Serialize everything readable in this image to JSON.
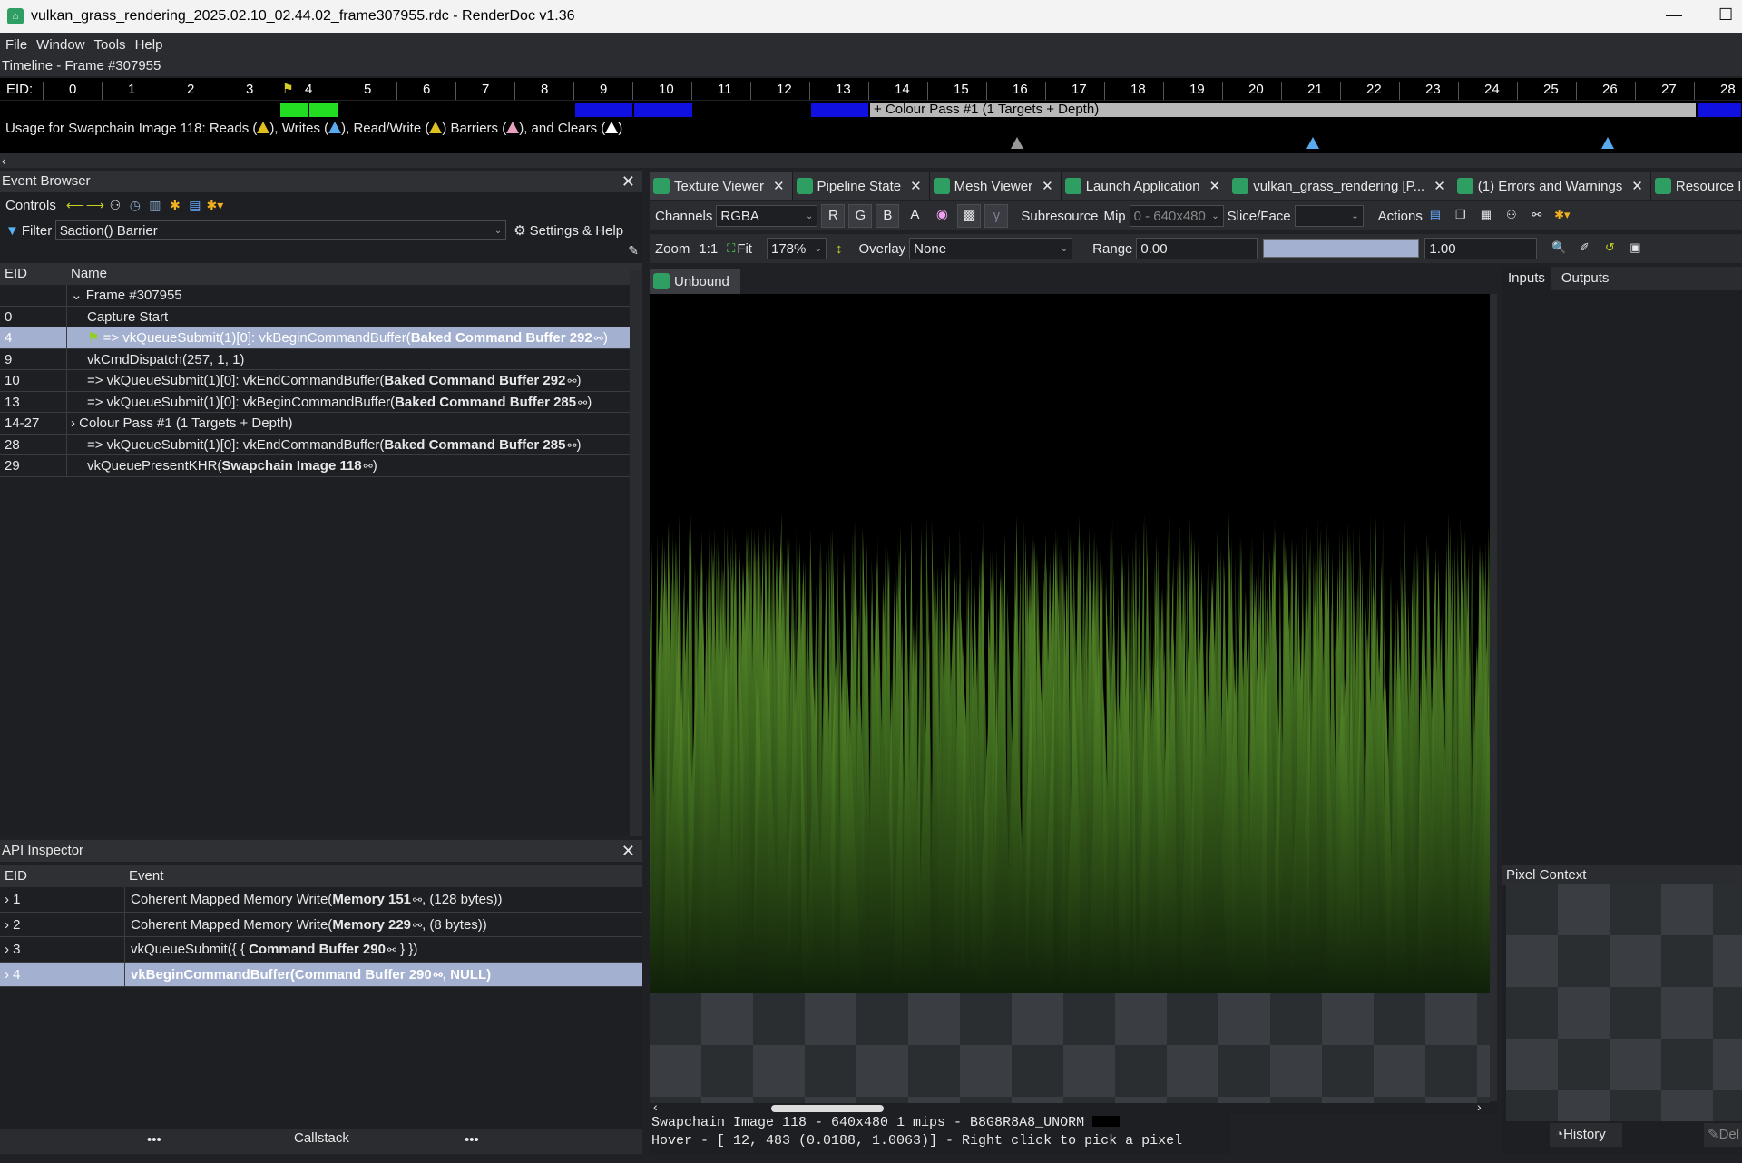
{
  "window": {
    "title": "vulkan_grass_rendering_2025.02.10_02.44.02_frame307955.rdc - RenderDoc v1.36"
  },
  "menu": [
    "File",
    "Window",
    "Tools",
    "Help"
  ],
  "timeline": {
    "title": "Timeline - Frame #307955",
    "eid_label": "EID:",
    "ticks": [
      "0",
      "1",
      "2",
      "3",
      "4",
      "5",
      "6",
      "7",
      "8",
      "9",
      "10",
      "11",
      "12",
      "13",
      "14",
      "15",
      "16",
      "17",
      "18",
      "19",
      "20",
      "21",
      "22",
      "23",
      "24",
      "25",
      "26",
      "27",
      "28"
    ],
    "pass_label": "+ Colour Pass #1 (1 Targets + Depth)",
    "usage": {
      "prefix": "Usage for Swapchain Image 118: Reads (",
      "writes": "), Writes (",
      "readwrite": "), Read/Write (",
      "barriers": ") Barriers (",
      "clears": "), and Clears (",
      "end": ")"
    },
    "colors": {
      "marker_green": "#22dd22",
      "marker_blue": "#1010e0",
      "pass_grey": "#b8b8b8",
      "reads": "#e0c020",
      "writes": "#5aaaf0",
      "barrier": "#e8a0c0"
    }
  },
  "event_browser": {
    "title": "Event Browser",
    "controls_label": "Controls",
    "filter_label": "Filter",
    "filter_value": "$action() Barrier",
    "settings_label": "Settings & Help",
    "col_eid": "EID",
    "col_name": "Name",
    "rows": [
      {
        "eid": "",
        "name": "Frame #307955",
        "expand": "v"
      },
      {
        "eid": "0",
        "name": "Capture Start"
      },
      {
        "eid": "4",
        "pre": "=> vkQueueSubmit(1)[0]: vkBeginCommandBuffer(",
        "bold": "Baked Command Buffer 292",
        "post": ")",
        "selected": true,
        "flag": true
      },
      {
        "eid": "9",
        "name": "vkCmdDispatch(257, 1, 1)"
      },
      {
        "eid": "10",
        "pre": "=> vkQueueSubmit(1)[0]: vkEndCommandBuffer(",
        "bold": "Baked Command Buffer 292",
        "post": ")"
      },
      {
        "eid": "13",
        "pre": "=> vkQueueSubmit(1)[0]: vkBeginCommandBuffer(",
        "bold": "Baked Command Buffer 285",
        "post": ")"
      },
      {
        "eid": "14-27",
        "name": "Colour Pass #1 (1 Targets + Depth)",
        "expand": ">"
      },
      {
        "eid": "28",
        "pre": "=> vkQueueSubmit(1)[0]: vkEndCommandBuffer(",
        "bold": "Baked Command Buffer 285",
        "post": ")"
      },
      {
        "eid": "29",
        "pre": "vkQueuePresentKHR(",
        "bold": "Swapchain Image 118",
        "post": ")"
      }
    ]
  },
  "api_inspector": {
    "title": "API Inspector",
    "col_eid": "EID",
    "col_event": "Event",
    "rows": [
      {
        "eid": "1",
        "pre": "Coherent Mapped Memory Write(",
        "bold": "Memory 151",
        "post": ", (128 bytes))"
      },
      {
        "eid": "2",
        "pre": "Coherent Mapped Memory Write(",
        "bold": "Memory 229",
        "post": ", (8 bytes))"
      },
      {
        "eid": "3",
        "pre": "vkQueueSubmit({ { ",
        "bold": "Command Buffer 290",
        "post": " } })"
      },
      {
        "eid": "4",
        "pre": "vkBeginCommandBuffer(",
        "bold": "Command Buffer 290",
        "post": ", NULL)",
        "selected": true
      }
    ],
    "callstack_label": "Callstack",
    "dots": "•••"
  },
  "tabs": [
    {
      "label": "Texture Viewer",
      "active": true
    },
    {
      "label": "Pipeline State"
    },
    {
      "label": "Mesh Viewer"
    },
    {
      "label": "Launch Application"
    },
    {
      "label": "vulkan_grass_rendering [P..."
    },
    {
      "label": "(1) Errors and Warnings"
    },
    {
      "label": "Resource Inspector"
    }
  ],
  "texture_viewer": {
    "channels_label": "Channels",
    "channels_value": "RGBA",
    "channel_buttons": [
      "R",
      "G",
      "B",
      "A"
    ],
    "subresource_label": "Subresource",
    "mip_label": "Mip",
    "mip_value": "0 - 640x480",
    "slice_label": "Slice/Face",
    "actions_label": "Actions",
    "zoom_label": "Zoom",
    "zoom_1to1": "1:1",
    "fit_label": "Fit",
    "zoom_value": "178%",
    "overlay_label": "Overlay",
    "overlay_value": "None",
    "range_label": "Range",
    "range_min": "0.00",
    "range_max": "1.00",
    "unbound_label": "Unbound",
    "status_line1": "Swapchain Image 118 - 640x480 1 mips - B8G8R8A8_UNORM",
    "status_line2": "Hover - [   12,  483 (0.0188, 1.0063)] - Right click to pick a pixel"
  },
  "side_panel": {
    "inputs_label": "Inputs",
    "outputs_label": "Outputs",
    "pixel_context_label": "Pixel Context",
    "history_label": "History",
    "debug_label": "Del"
  }
}
